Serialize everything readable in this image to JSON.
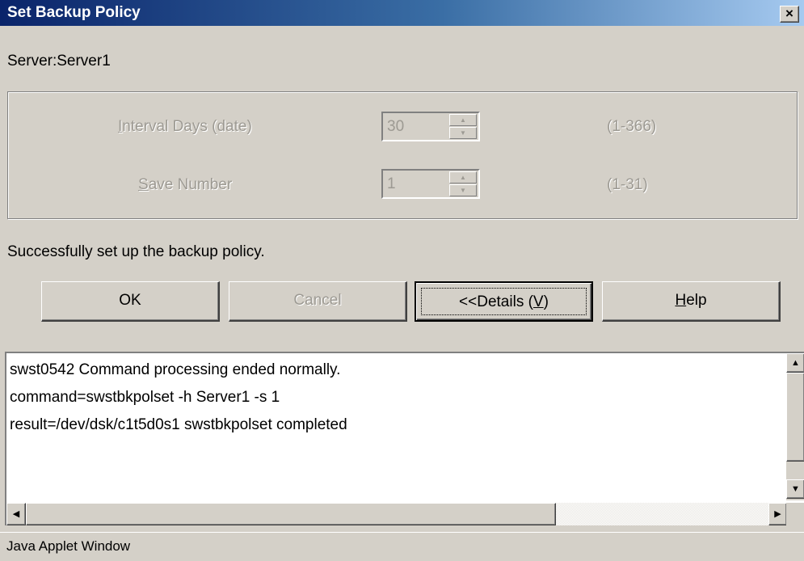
{
  "window": {
    "title": "Set Backup Policy",
    "close_label": "×"
  },
  "server": {
    "label": "Server:Server1"
  },
  "policy": {
    "interval": {
      "label_mnemonic": "I",
      "label_rest": "nterval Days (date)",
      "value": "30",
      "range": "(1-366)"
    },
    "save_number": {
      "label_mnemonic": "S",
      "label_rest": "ave Number",
      "value": "1",
      "range": "(1-31)"
    }
  },
  "status_message": "Successfully set up the backup policy.",
  "buttons": {
    "ok": "OK",
    "cancel": "Cancel",
    "details_prefix": "<<Details  (",
    "details_mnemonic": "V",
    "details_suffix": ")",
    "help_mnemonic": "H",
    "help_rest": "elp"
  },
  "log": {
    "lines": [
      "swst0542 Command processing ended normally.",
      "command=swstbkpolset -h Server1 -s 1",
      "result=/dev/dsk/c1t5d0s1 swstbkpolset completed"
    ]
  },
  "icons": {
    "up": "▲",
    "down": "▼",
    "left": "◀",
    "right": "▶"
  },
  "footer": {
    "text": "Java Applet Window"
  }
}
